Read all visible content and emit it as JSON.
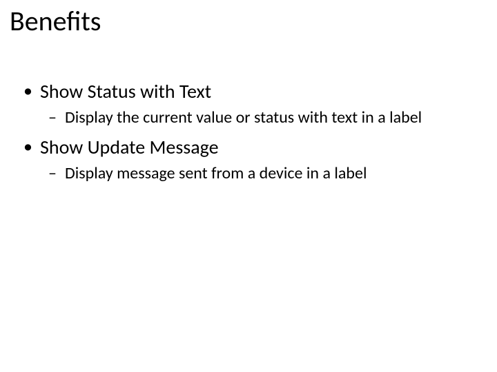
{
  "title": "Benefits",
  "items": [
    {
      "heading": "Show Status with Text",
      "sub": "Display the current value or status with text in a label"
    },
    {
      "heading": "Show Update Message",
      "sub": " Display message sent from a device in a label"
    }
  ]
}
